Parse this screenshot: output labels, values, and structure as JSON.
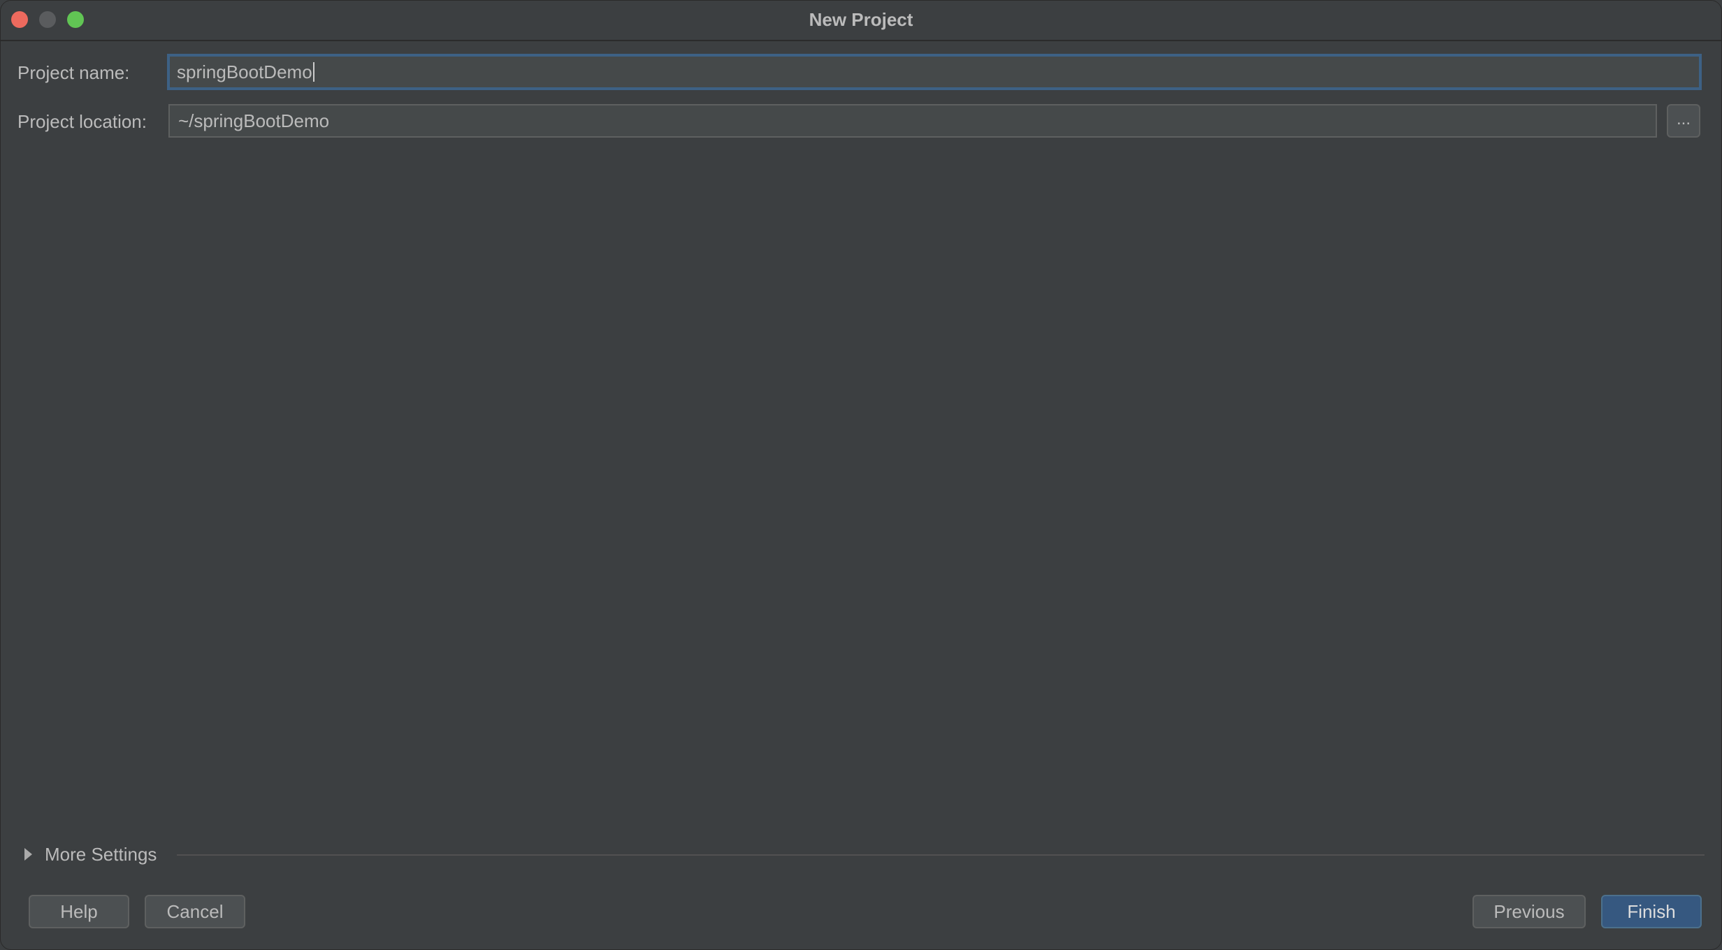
{
  "window": {
    "title": "New Project"
  },
  "form": {
    "name_label": "Project name:",
    "name_value": "springBootDemo",
    "location_label": "Project location:",
    "location_value": "~/springBootDemo",
    "browse_label": "..."
  },
  "more_settings": {
    "label": "More Settings",
    "expanded": false
  },
  "buttons": {
    "help": "Help",
    "cancel": "Cancel",
    "previous": "Previous",
    "finish": "Finish"
  },
  "colors": {
    "background": "#3c3f41",
    "field_background": "#45494a",
    "focus_border": "#3d6185",
    "primary_button": "#365880",
    "close": "#ed6a5e",
    "maximize": "#61c554"
  },
  "icons": {
    "expand": "triangle-right-icon"
  }
}
